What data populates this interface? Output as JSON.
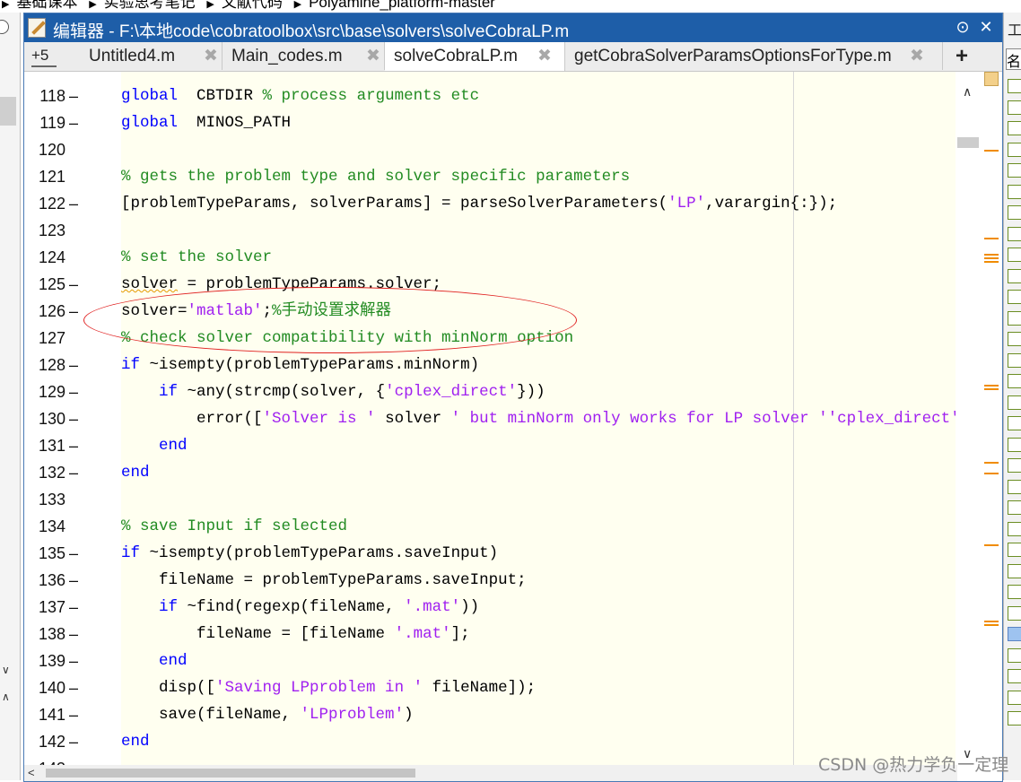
{
  "breadcrumb": [
    "基础课本",
    "实验思考笔记",
    "文献代码",
    "Polyamine_platform-master"
  ],
  "window": {
    "title": "编辑器 - F:\\本地code\\cobratoolbox\\src\\base\\solvers\\solveCobraLP.m"
  },
  "tabs": {
    "overflow_label": "+5",
    "items": [
      {
        "label": "Untitled4.m",
        "close": "✖"
      },
      {
        "label": "Main_codes.m",
        "close": "✖"
      },
      {
        "label": "solveCobraLP.m",
        "close": "✖",
        "active": true
      },
      {
        "label": "getCobraSolverParamsOptionsForType.m",
        "close": "✖"
      }
    ],
    "add_label": "+"
  },
  "lines": [
    {
      "n": "118",
      "dash": "–",
      "segs": [
        [
          "kw",
          "global"
        ],
        [
          "",
          "  "
        ],
        [
          "",
          "CBTDIR "
        ],
        [
          "cm",
          "% process arguments etc"
        ]
      ]
    },
    {
      "n": "119",
      "dash": "–",
      "segs": [
        [
          "kw",
          "global"
        ],
        [
          "",
          "  MINOS_PATH"
        ]
      ]
    },
    {
      "n": "120",
      "dash": "",
      "segs": []
    },
    {
      "n": "121",
      "dash": "",
      "segs": [
        [
          "cm",
          "% gets the problem type and solver specific parameters"
        ]
      ]
    },
    {
      "n": "122",
      "dash": "–",
      "segs": [
        [
          "",
          "[problemTypeParams, solverParams] = parseSolverParameters("
        ],
        [
          "st",
          "'LP'"
        ],
        [
          "",
          ",varargin{:});"
        ]
      ]
    },
    {
      "n": "123",
      "dash": "",
      "segs": []
    },
    {
      "n": "124",
      "dash": "",
      "segs": [
        [
          "cm",
          "% set the solver"
        ]
      ]
    },
    {
      "n": "125",
      "dash": "–",
      "segs": [
        [
          "wv",
          "solver"
        ],
        [
          "",
          " = problemTypeParams.solver;"
        ]
      ]
    },
    {
      "n": "126",
      "dash": "–",
      "segs": [
        [
          "",
          "solver="
        ],
        [
          "st",
          "'matlab'"
        ],
        [
          "",
          ";"
        ],
        [
          "cm",
          "%手动设置求解器"
        ]
      ]
    },
    {
      "n": "127",
      "dash": "",
      "segs": [
        [
          "cm",
          "% check solver compatibility with minNorm option"
        ]
      ]
    },
    {
      "n": "128",
      "dash": "–",
      "segs": [
        [
          "kw",
          "if"
        ],
        [
          "",
          " ~isempty(problemTypeParams.minNorm)"
        ]
      ]
    },
    {
      "n": "129",
      "dash": "–",
      "segs": [
        [
          "",
          "    "
        ],
        [
          "kw",
          "if"
        ],
        [
          "",
          " ~any(strcmp(solver, {"
        ],
        [
          "st",
          "'cplex_direct'"
        ],
        [
          "",
          "}))"
        ]
      ]
    },
    {
      "n": "130",
      "dash": "–",
      "segs": [
        [
          "",
          "        error(["
        ],
        [
          "st",
          "'Solver is '"
        ],
        [
          "",
          " solver "
        ],
        [
          "st",
          "' but minNorm only works for LP solver ''cplex_direct'' fr"
        ]
      ]
    },
    {
      "n": "131",
      "dash": "–",
      "segs": [
        [
          "",
          "    "
        ],
        [
          "kw",
          "end"
        ]
      ]
    },
    {
      "n": "132",
      "dash": "–",
      "segs": [
        [
          "kw",
          "end"
        ]
      ]
    },
    {
      "n": "133",
      "dash": "",
      "segs": []
    },
    {
      "n": "134",
      "dash": "",
      "segs": [
        [
          "cm",
          "% save Input if selected"
        ]
      ]
    },
    {
      "n": "135",
      "dash": "–",
      "segs": [
        [
          "kw",
          "if"
        ],
        [
          "",
          " ~isempty(problemTypeParams.saveInput)"
        ]
      ]
    },
    {
      "n": "136",
      "dash": "–",
      "segs": [
        [
          "",
          "    fileName = problemTypeParams.saveInput;"
        ]
      ]
    },
    {
      "n": "137",
      "dash": "–",
      "segs": [
        [
          "",
          "    "
        ],
        [
          "kw",
          "if"
        ],
        [
          "",
          " ~find(regexp(fileName, "
        ],
        [
          "st",
          "'.mat'"
        ],
        [
          "",
          "))"
        ]
      ]
    },
    {
      "n": "138",
      "dash": "–",
      "segs": [
        [
          "",
          "        fileName = [fileName "
        ],
        [
          "st",
          "'.mat'"
        ],
        [
          "",
          "];"
        ]
      ]
    },
    {
      "n": "139",
      "dash": "–",
      "segs": [
        [
          "",
          "    "
        ],
        [
          "kw",
          "end"
        ]
      ]
    },
    {
      "n": "140",
      "dash": "–",
      "segs": [
        [
          "",
          "    disp(["
        ],
        [
          "st",
          "'Saving LPproblem in '"
        ],
        [
          "",
          " fileName]);"
        ]
      ]
    },
    {
      "n": "141",
      "dash": "–",
      "segs": [
        [
          "",
          "    save(fileName, "
        ],
        [
          "st",
          "'LPproblem'"
        ],
        [
          "",
          ")"
        ]
      ]
    },
    {
      "n": "142",
      "dash": "–",
      "segs": [
        [
          "kw",
          "end"
        ]
      ]
    },
    {
      "n": "143",
      "dash": "",
      "segs": []
    }
  ],
  "colors": {
    "keyword": "#0000ff",
    "comment": "#228b22",
    "string": "#a020f0",
    "title_bar": "#1e5ea8",
    "code_background": "#fffff0",
    "annotation": "#e02020",
    "marker": "#f08c00"
  },
  "right_panel": {
    "title": "工",
    "item": "名"
  },
  "watermark": "CSDN @热力学负一定理"
}
